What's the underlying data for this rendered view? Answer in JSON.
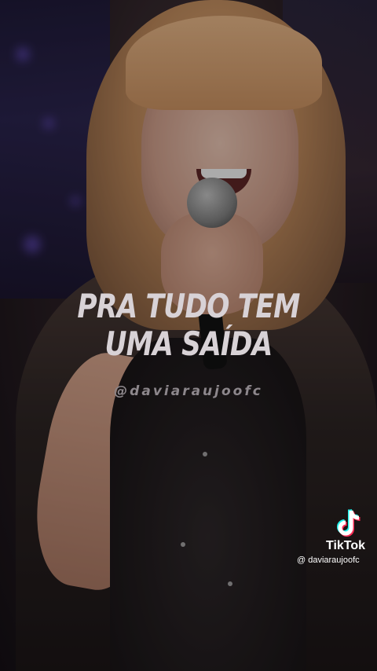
{
  "caption": {
    "line1": "PRA TUDO TEM",
    "line2": "UMA SAÍDA"
  },
  "center_handle": "@daviaraujoofc",
  "watermark": {
    "brand": "TikTok",
    "username": "@ daviaraujoofc",
    "icon": "tiktok-logo-icon"
  },
  "colors": {
    "caption_text": "#d8d2d6",
    "handle_text": "#8d878c",
    "tiktok_cyan": "#25f4ee",
    "tiktok_red": "#fe2c55"
  }
}
